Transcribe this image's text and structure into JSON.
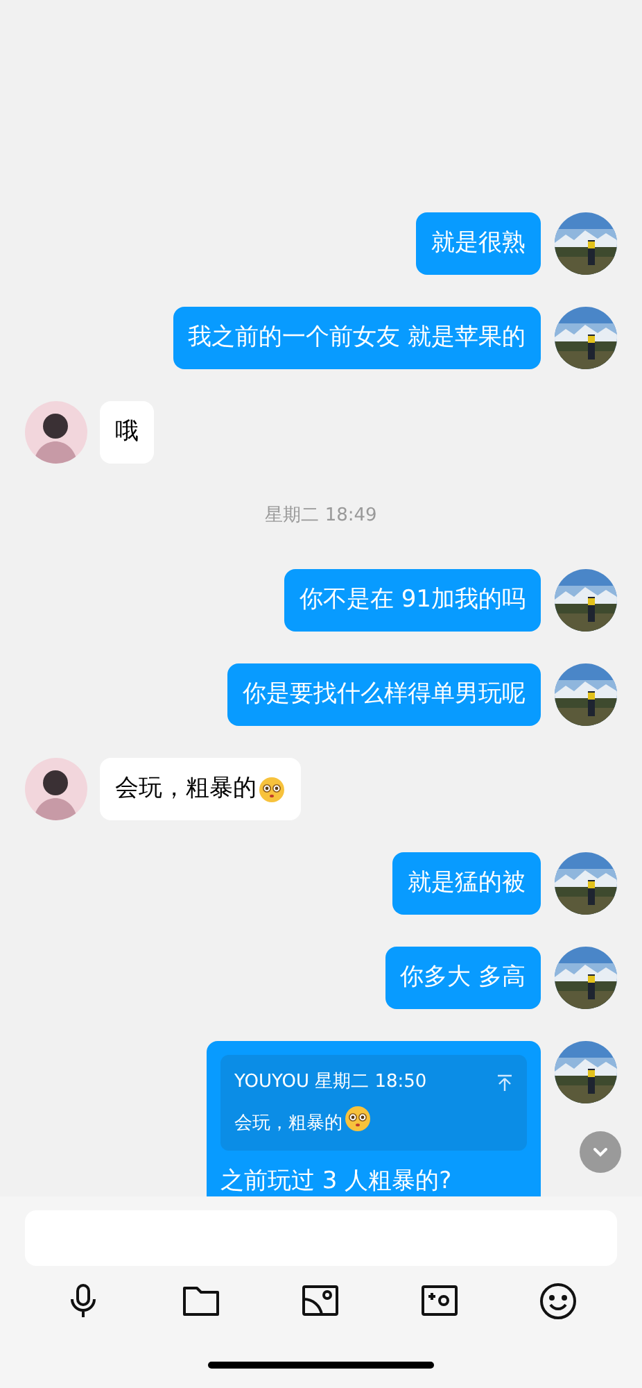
{
  "messages": [
    {
      "kind": "text",
      "outgoing": true,
      "text": "就是很熟",
      "emoji": false
    },
    {
      "kind": "text",
      "outgoing": true,
      "text": "我之前的一个前女友 就是苹果的",
      "emoji": false
    },
    {
      "kind": "text",
      "outgoing": false,
      "text": "哦",
      "emoji": false
    },
    {
      "kind": "time",
      "text": "星期二 18:49"
    },
    {
      "kind": "text",
      "outgoing": true,
      "text": "你不是在 91加我的吗",
      "emoji": false
    },
    {
      "kind": "text",
      "outgoing": true,
      "text": "你是要找什么样得单男玩呢",
      "emoji": false
    },
    {
      "kind": "text",
      "outgoing": false,
      "text": "会玩，粗暴的",
      "emoji": true
    },
    {
      "kind": "text",
      "outgoing": true,
      "text": "就是猛的被",
      "emoji": false
    },
    {
      "kind": "text",
      "outgoing": true,
      "text": "你多大 多高",
      "emoji": false
    },
    {
      "kind": "quote",
      "outgoing": true,
      "quote_header": "YOUYOU 星期二 18:50",
      "quote_text": "会玩，粗暴的",
      "quote_emoji": true,
      "text": "之前玩过 3 人粗暴的?"
    }
  ]
}
